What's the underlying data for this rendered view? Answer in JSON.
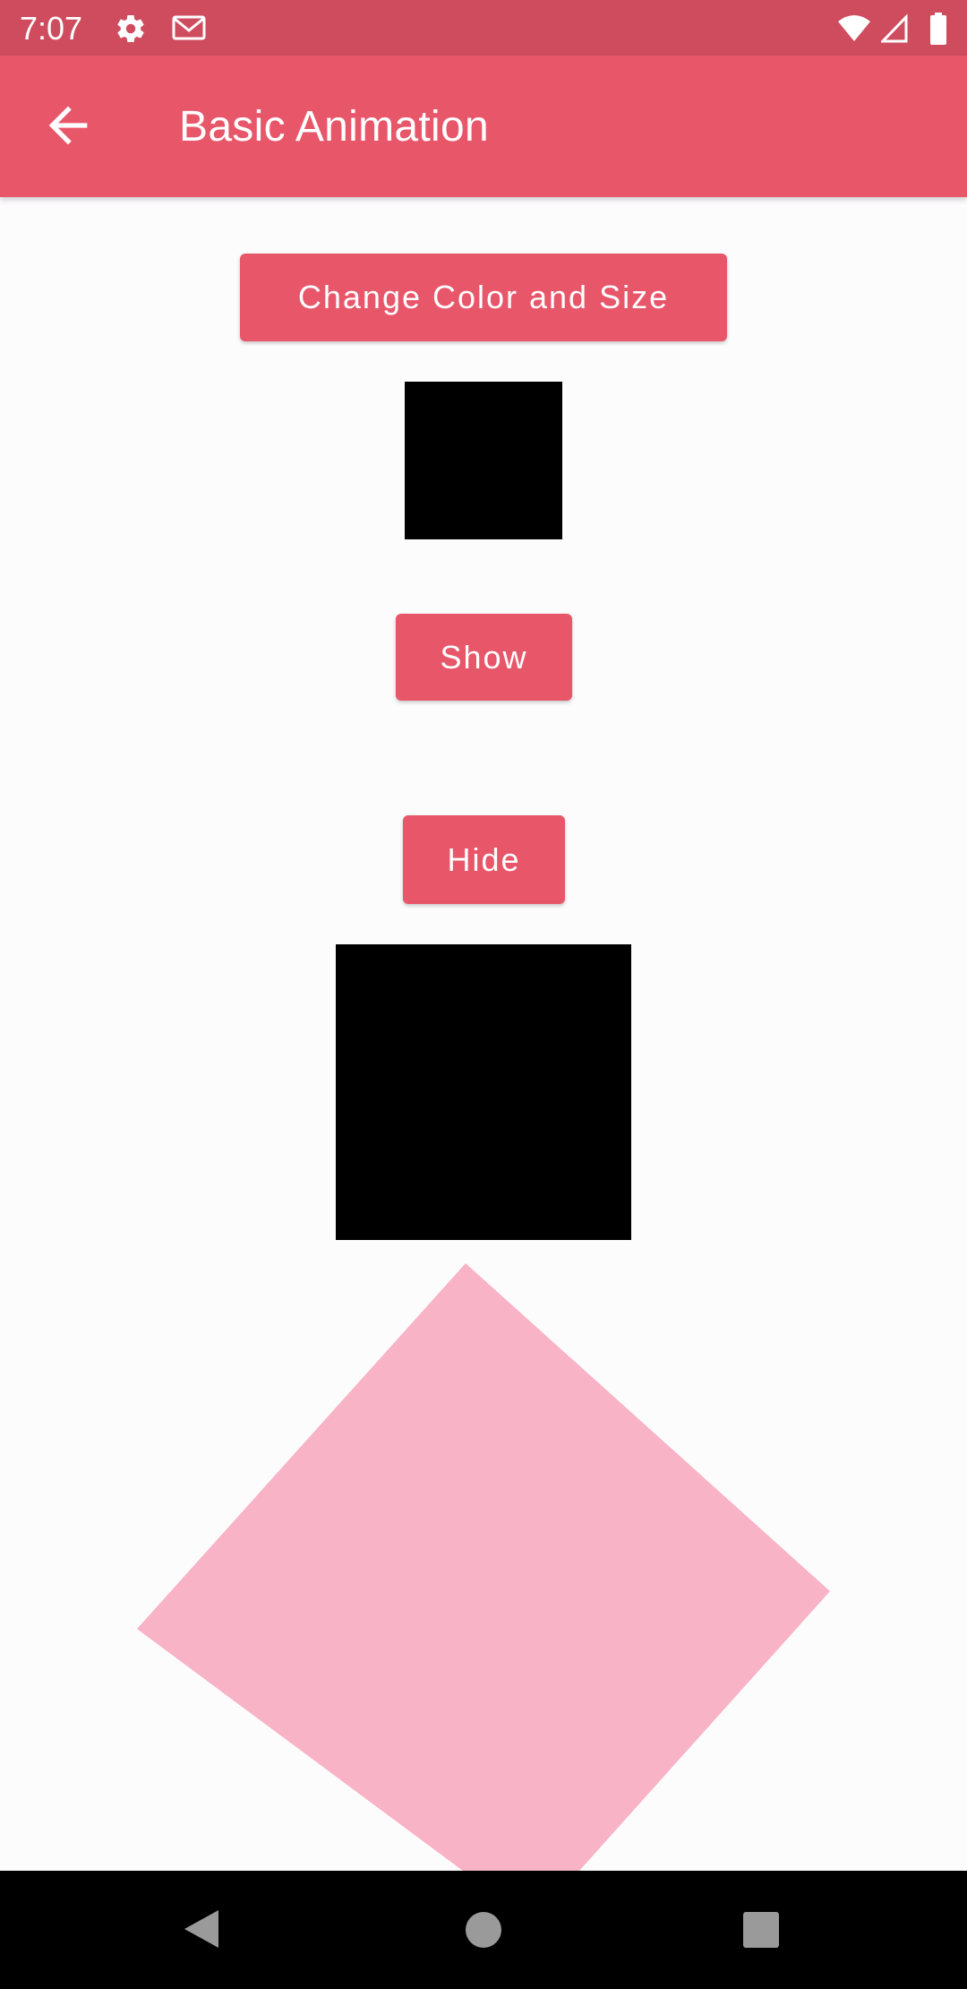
{
  "status_bar": {
    "time": "7:07",
    "icons": [
      "gear-icon",
      "gmail-icon",
      "wifi-icon",
      "signal-icon",
      "battery-icon"
    ]
  },
  "app_bar": {
    "title": "Basic Animation",
    "back_icon": "arrow-back-icon"
  },
  "buttons": {
    "change_color_size": "Change Color and Size",
    "show": "Show",
    "hide": "Hide"
  },
  "colors": {
    "status_bar": "#cf4c5f",
    "accent": "#e8566a",
    "box": "#000000",
    "diamond": "#f8b3c6",
    "background": "#fdfcfd",
    "nav_bar": "#000000"
  },
  "navigation": {
    "icons": [
      "nav-back-icon",
      "nav-home-icon",
      "nav-recents-icon"
    ]
  }
}
